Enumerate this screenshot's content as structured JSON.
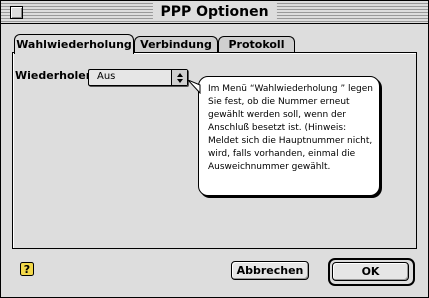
{
  "window": {
    "title": "PPP Optionen"
  },
  "tabs": [
    {
      "label": "Wahlwiederholung",
      "active": true
    },
    {
      "label": "Verbindung",
      "active": false
    },
    {
      "label": "Protokoll",
      "active": false
    }
  ],
  "redial": {
    "label": "Wiederholen:",
    "selected": "Aus"
  },
  "balloon": {
    "text": "Im Menü “Wahlwiederholung ” legen Sie fest, ob die Nummer erneut gewählt werden soll, wenn der Anschluß besetzt ist. (Hinweis: Meldet sich die Hauptnummer nicht, wird, falls vorhanden, einmal die Ausweichnummer gewählt."
  },
  "buttons": {
    "cancel": "Abbrechen",
    "ok": "OK"
  },
  "icons": {
    "help": "help-icon",
    "close": "close-box-icon"
  }
}
